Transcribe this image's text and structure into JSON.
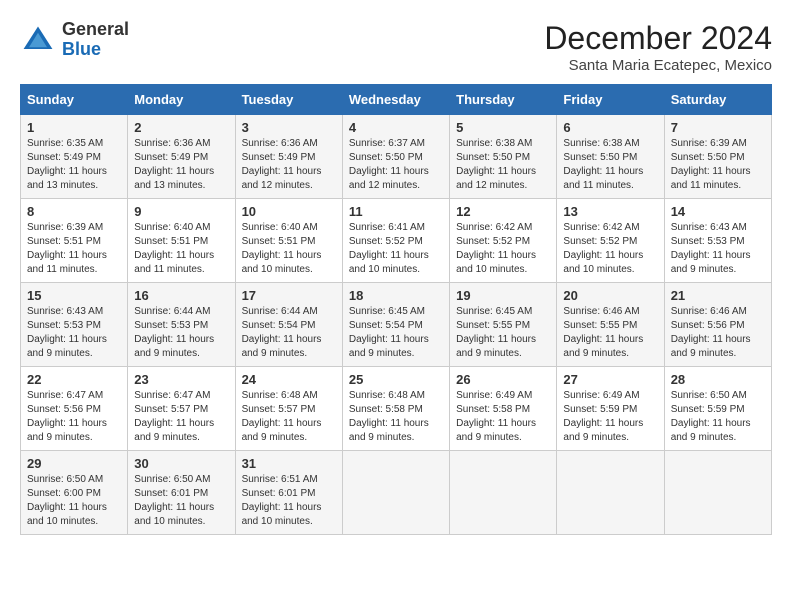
{
  "logo": {
    "general": "General",
    "blue": "Blue"
  },
  "title": "December 2024",
  "subtitle": "Santa Maria Ecatepec, Mexico",
  "days_of_week": [
    "Sunday",
    "Monday",
    "Tuesday",
    "Wednesday",
    "Thursday",
    "Friday",
    "Saturday"
  ],
  "weeks": [
    [
      {
        "day": 1,
        "sunrise": "6:35 AM",
        "sunset": "5:49 PM",
        "daylight": "11 hours and 13 minutes."
      },
      {
        "day": 2,
        "sunrise": "6:36 AM",
        "sunset": "5:49 PM",
        "daylight": "11 hours and 13 minutes."
      },
      {
        "day": 3,
        "sunrise": "6:36 AM",
        "sunset": "5:49 PM",
        "daylight": "11 hours and 12 minutes."
      },
      {
        "day": 4,
        "sunrise": "6:37 AM",
        "sunset": "5:50 PM",
        "daylight": "11 hours and 12 minutes."
      },
      {
        "day": 5,
        "sunrise": "6:38 AM",
        "sunset": "5:50 PM",
        "daylight": "11 hours and 12 minutes."
      },
      {
        "day": 6,
        "sunrise": "6:38 AM",
        "sunset": "5:50 PM",
        "daylight": "11 hours and 11 minutes."
      },
      {
        "day": 7,
        "sunrise": "6:39 AM",
        "sunset": "5:50 PM",
        "daylight": "11 hours and 11 minutes."
      }
    ],
    [
      {
        "day": 8,
        "sunrise": "6:39 AM",
        "sunset": "5:51 PM",
        "daylight": "11 hours and 11 minutes."
      },
      {
        "day": 9,
        "sunrise": "6:40 AM",
        "sunset": "5:51 PM",
        "daylight": "11 hours and 11 minutes."
      },
      {
        "day": 10,
        "sunrise": "6:40 AM",
        "sunset": "5:51 PM",
        "daylight": "11 hours and 10 minutes."
      },
      {
        "day": 11,
        "sunrise": "6:41 AM",
        "sunset": "5:52 PM",
        "daylight": "11 hours and 10 minutes."
      },
      {
        "day": 12,
        "sunrise": "6:42 AM",
        "sunset": "5:52 PM",
        "daylight": "11 hours and 10 minutes."
      },
      {
        "day": 13,
        "sunrise": "6:42 AM",
        "sunset": "5:52 PM",
        "daylight": "11 hours and 10 minutes."
      },
      {
        "day": 14,
        "sunrise": "6:43 AM",
        "sunset": "5:53 PM",
        "daylight": "11 hours and 9 minutes."
      }
    ],
    [
      {
        "day": 15,
        "sunrise": "6:43 AM",
        "sunset": "5:53 PM",
        "daylight": "11 hours and 9 minutes."
      },
      {
        "day": 16,
        "sunrise": "6:44 AM",
        "sunset": "5:53 PM",
        "daylight": "11 hours and 9 minutes."
      },
      {
        "day": 17,
        "sunrise": "6:44 AM",
        "sunset": "5:54 PM",
        "daylight": "11 hours and 9 minutes."
      },
      {
        "day": 18,
        "sunrise": "6:45 AM",
        "sunset": "5:54 PM",
        "daylight": "11 hours and 9 minutes."
      },
      {
        "day": 19,
        "sunrise": "6:45 AM",
        "sunset": "5:55 PM",
        "daylight": "11 hours and 9 minutes."
      },
      {
        "day": 20,
        "sunrise": "6:46 AM",
        "sunset": "5:55 PM",
        "daylight": "11 hours and 9 minutes."
      },
      {
        "day": 21,
        "sunrise": "6:46 AM",
        "sunset": "5:56 PM",
        "daylight": "11 hours and 9 minutes."
      }
    ],
    [
      {
        "day": 22,
        "sunrise": "6:47 AM",
        "sunset": "5:56 PM",
        "daylight": "11 hours and 9 minutes."
      },
      {
        "day": 23,
        "sunrise": "6:47 AM",
        "sunset": "5:57 PM",
        "daylight": "11 hours and 9 minutes."
      },
      {
        "day": 24,
        "sunrise": "6:48 AM",
        "sunset": "5:57 PM",
        "daylight": "11 hours and 9 minutes."
      },
      {
        "day": 25,
        "sunrise": "6:48 AM",
        "sunset": "5:58 PM",
        "daylight": "11 hours and 9 minutes."
      },
      {
        "day": 26,
        "sunrise": "6:49 AM",
        "sunset": "5:58 PM",
        "daylight": "11 hours and 9 minutes."
      },
      {
        "day": 27,
        "sunrise": "6:49 AM",
        "sunset": "5:59 PM",
        "daylight": "11 hours and 9 minutes."
      },
      {
        "day": 28,
        "sunrise": "6:50 AM",
        "sunset": "5:59 PM",
        "daylight": "11 hours and 9 minutes."
      }
    ],
    [
      {
        "day": 29,
        "sunrise": "6:50 AM",
        "sunset": "6:00 PM",
        "daylight": "11 hours and 10 minutes."
      },
      {
        "day": 30,
        "sunrise": "6:50 AM",
        "sunset": "6:01 PM",
        "daylight": "11 hours and 10 minutes."
      },
      {
        "day": 31,
        "sunrise": "6:51 AM",
        "sunset": "6:01 PM",
        "daylight": "11 hours and 10 minutes."
      },
      null,
      null,
      null,
      null
    ]
  ]
}
